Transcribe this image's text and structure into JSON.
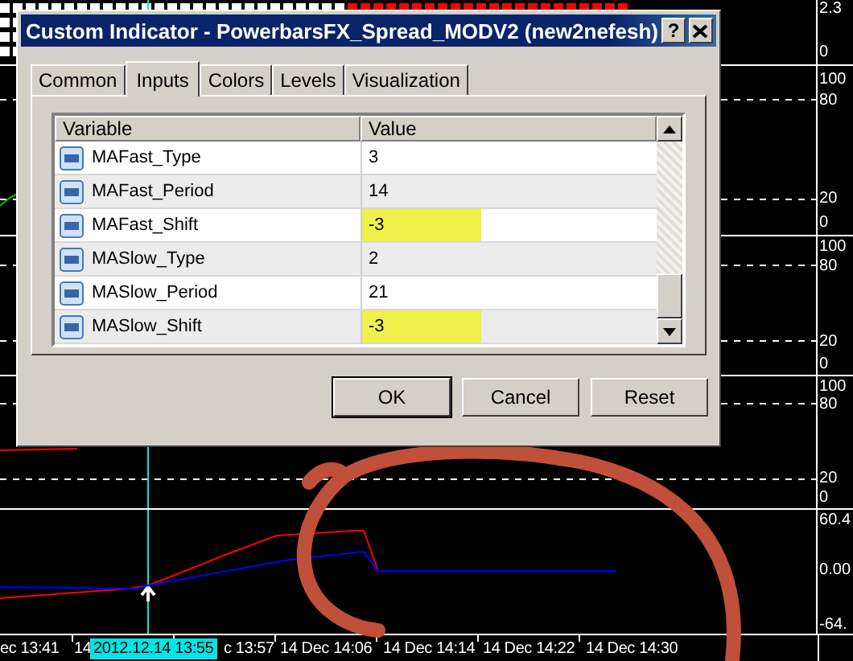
{
  "chart": {
    "panels": [
      {
        "labels": [
          "2.3",
          "0"
        ]
      },
      {
        "labels": [
          "100",
          "80",
          "20",
          "0"
        ]
      },
      {
        "labels": [
          "100",
          "80",
          "20",
          "0"
        ]
      },
      {
        "labels": [
          "100",
          "80",
          "20",
          "0"
        ]
      },
      {
        "labels": [
          "60.4",
          "0.00",
          "-64."
        ]
      }
    ],
    "time_axis": [
      {
        "text": "ec 13:41",
        "highlighted": false
      },
      {
        "text": "14",
        "highlighted": false
      },
      {
        "text": "2012.12.14 13:55",
        "highlighted": true
      },
      {
        "text": "c 13:57",
        "highlighted": false
      },
      {
        "text": "14 Dec 14:06",
        "highlighted": false
      },
      {
        "text": "14 Dec 14:14",
        "highlighted": false
      },
      {
        "text": "14 Dec 14:22",
        "highlighted": false
      },
      {
        "text": "14 Dec 14:30",
        "highlighted": false
      }
    ]
  },
  "dialog": {
    "title": "Custom Indicator - PowerbarsFX_Spread_MODV2 (new2nefesh)",
    "help_button": "?",
    "tabs": [
      {
        "label": "Common",
        "selected": false
      },
      {
        "label": "Inputs",
        "selected": true
      },
      {
        "label": "Colors",
        "selected": false
      },
      {
        "label": "Levels",
        "selected": false
      },
      {
        "label": "Visualization",
        "selected": false
      }
    ],
    "table": {
      "columns": [
        "Variable",
        "Value"
      ],
      "rows": [
        {
          "name": "MAFast_Type",
          "value": "3",
          "highlighted": false
        },
        {
          "name": "MAFast_Period",
          "value": "14",
          "highlighted": false
        },
        {
          "name": "MAFast_Shift",
          "value": "-3",
          "highlighted": true
        },
        {
          "name": "MASlow_Type",
          "value": "2",
          "highlighted": false
        },
        {
          "name": "MASlow_Period",
          "value": "21",
          "highlighted": false
        },
        {
          "name": "MASlow_Shift",
          "value": "-3",
          "highlighted": true
        }
      ]
    },
    "buttons": [
      {
        "label": "OK",
        "default": true
      },
      {
        "label": "Cancel",
        "default": false
      },
      {
        "label": "Reset",
        "default": false
      }
    ]
  }
}
